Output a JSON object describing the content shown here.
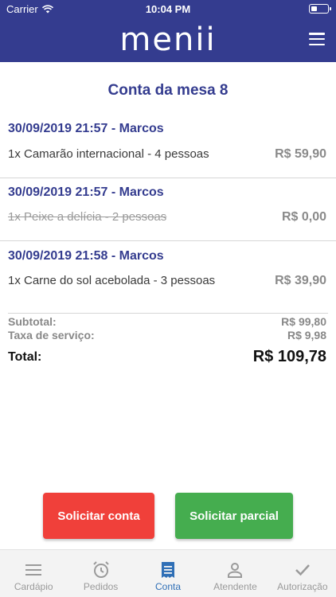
{
  "status": {
    "carrier": "Carrier",
    "time": "10:04 PM"
  },
  "header": {
    "logo": "menii"
  },
  "page_title": "Conta da mesa 8",
  "orders": [
    {
      "header": "30/09/2019 21:57 - Marcos",
      "item": "1x Camarão internacional - 4 pessoas",
      "price": "R$ 59,90",
      "cancelled": false
    },
    {
      "header": "30/09/2019 21:57 - Marcos",
      "item": "1x Peixe a delícia - 2 pessoas",
      "price": "R$ 0,00",
      "cancelled": true
    },
    {
      "header": "30/09/2019 21:58 - Marcos",
      "item": "1x Carne do sol acebolada - 3 pessoas",
      "price": "R$ 39,90",
      "cancelled": false
    }
  ],
  "summary": {
    "subtotal_label": "Subtotal:",
    "subtotal": "R$ 99,80",
    "service_label": "Taxa de serviço:",
    "service": "R$ 9,98",
    "total_label": "Total:",
    "total": "R$ 109,78"
  },
  "buttons": {
    "request_bill": "Solicitar conta",
    "request_partial": "Solicitar parcial"
  },
  "tabs": [
    {
      "label": "Cardápio",
      "icon": "menu-list-icon",
      "active": false
    },
    {
      "label": "Pedidos",
      "icon": "alarm-clock-icon",
      "active": false
    },
    {
      "label": "Conta",
      "icon": "receipt-icon",
      "active": true
    },
    {
      "label": "Atendente",
      "icon": "person-icon",
      "active": false
    },
    {
      "label": "Autorização",
      "icon": "checkmark-icon",
      "active": false
    }
  ],
  "colors": {
    "primary": "#343c8f",
    "red": "#f0403a",
    "green": "#45ad4f",
    "tab_active": "#2f6fb6"
  }
}
